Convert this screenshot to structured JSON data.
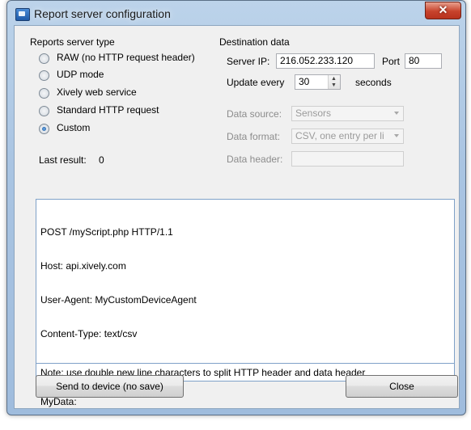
{
  "window": {
    "title": "Report server configuration",
    "close_glyph": "✕"
  },
  "server_type": {
    "heading": "Reports server type",
    "options": [
      {
        "label": "RAW (no HTTP request header)",
        "checked": false
      },
      {
        "label": "UDP mode",
        "checked": false
      },
      {
        "label": "Xively web service",
        "checked": false
      },
      {
        "label": "Standard HTTP request",
        "checked": false
      },
      {
        "label": "Custom",
        "checked": true
      }
    ]
  },
  "destination": {
    "heading": "Destination data",
    "server_ip_label": "Server IP:",
    "server_ip": "216.052.233.120",
    "port_label": "Port",
    "port": "80",
    "update_label": "Update every",
    "update_value": "30",
    "update_unit": "seconds"
  },
  "data_settings": {
    "source_label": "Data source:",
    "source_value": "Sensors",
    "format_label": "Data format:",
    "format_value": "CSV, one entry per li",
    "header_label": "Data header:",
    "header_value": ""
  },
  "status": {
    "label": "Last result:",
    "value": "0"
  },
  "request_text": [
    "POST /myScript.php HTTP/1.1",
    "Host: api.xively.com",
    "User-Agent: MyCustomDeviceAgent",
    "Content-Type: text/csv",
    "",
    "MyData:"
  ],
  "note": "Note: use double new line characters to split HTTP header and data header",
  "buttons": {
    "send": "Send to device (no save)",
    "close": "Close"
  },
  "icons": {
    "app": "app-window-icon",
    "close": "close-icon"
  }
}
